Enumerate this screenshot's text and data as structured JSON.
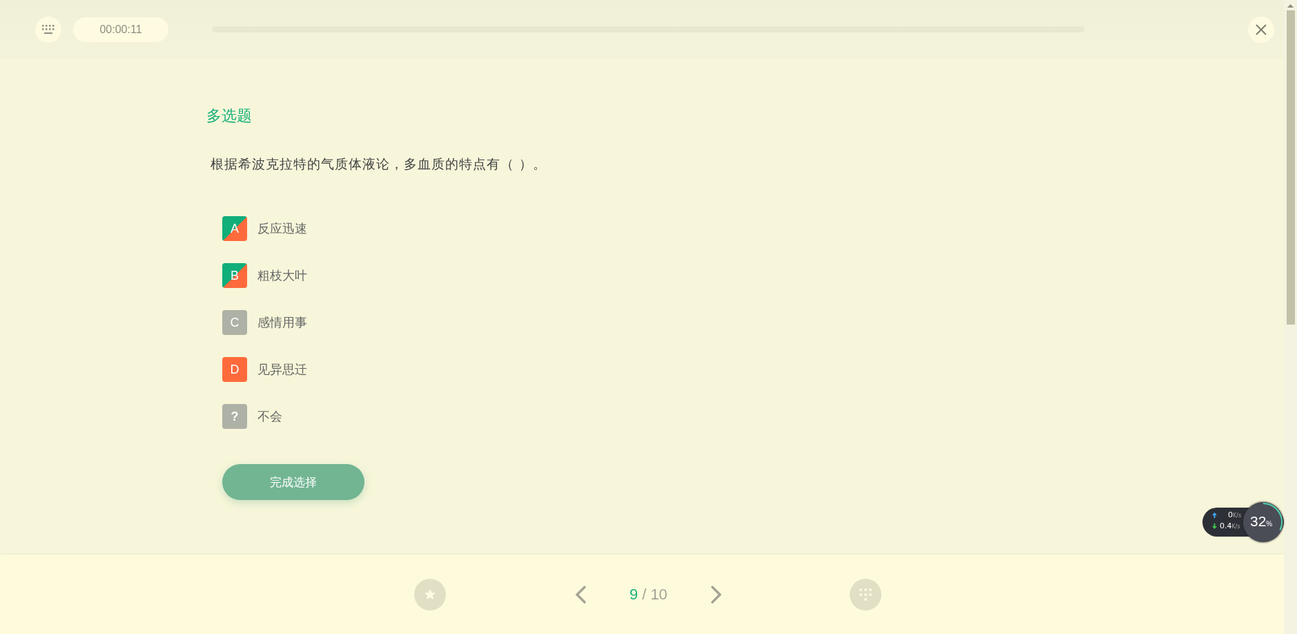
{
  "timer": "00:00:11",
  "question": {
    "type_label": "多选题",
    "text": "根据希波克拉特的气质体液论，多血质的特点有（ ）。",
    "options": [
      {
        "kind": "letter",
        "letter": "A",
        "text": "反应迅速",
        "selected": true,
        "correct": true
      },
      {
        "kind": "letter",
        "letter": "B",
        "text": "粗枝大叶",
        "selected": true,
        "correct": true
      },
      {
        "kind": "letter",
        "letter": "C",
        "text": "感情用事",
        "selected": false,
        "correct": false
      },
      {
        "kind": "letter",
        "letter": "D",
        "text": "见异思迁",
        "selected": true,
        "correct": false
      },
      {
        "kind": "unknown",
        "letter": "?",
        "text": "不会",
        "selected": false,
        "correct": false
      }
    ],
    "submit": "完成选择"
  },
  "pager": {
    "current": "9",
    "separator": "/",
    "total": "10"
  },
  "net_widget": {
    "upload": {
      "value": "0",
      "unit": "K/s"
    },
    "download": {
      "value": "0.4",
      "unit": "K/s"
    },
    "usage": {
      "value": "32",
      "unit": "%"
    }
  }
}
